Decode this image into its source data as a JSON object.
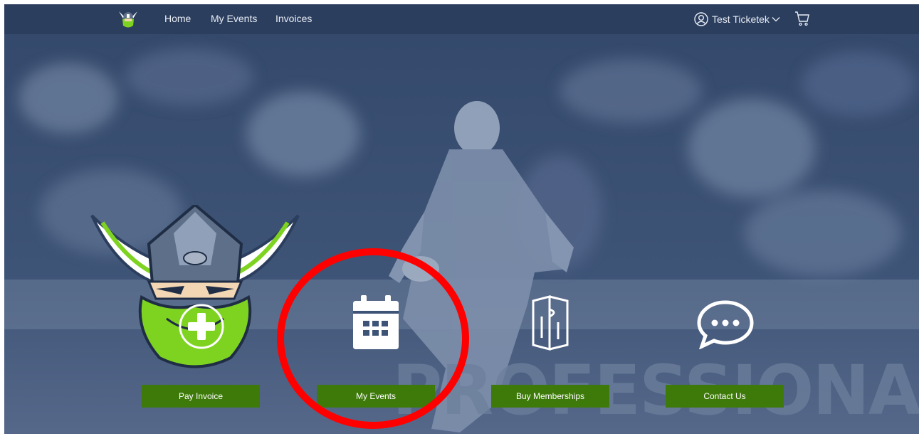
{
  "nav": {
    "logo_icon": "raiders-viking-logo-icon",
    "links": [
      {
        "label": "Home"
      },
      {
        "label": "My Events"
      },
      {
        "label": "Invoices"
      }
    ],
    "user": {
      "icon": "user-circle-icon",
      "name": "Test Ticketek",
      "dropdown_icon": "chevron-down-icon"
    },
    "cart_icon": "shopping-cart-icon"
  },
  "hero": {
    "background_text": "PROFESSIONALS",
    "mascot_icon": "raiders-viking-mascot-icon"
  },
  "actions": [
    {
      "label": "Pay Invoice",
      "icon": "plus-circle-icon"
    },
    {
      "label": "My Events",
      "icon": "calendar-icon"
    },
    {
      "label": "Buy Memberships",
      "icon": "ticket-icon"
    },
    {
      "label": "Contact Us",
      "icon": "chat-bubble-icon"
    }
  ],
  "colors": {
    "navbar": "#2c3e5e",
    "hero_tint": "#3e5477",
    "button_green": "#3d7a0a",
    "highlight_red": "#ff0000",
    "mascot_green": "#7ed321"
  }
}
